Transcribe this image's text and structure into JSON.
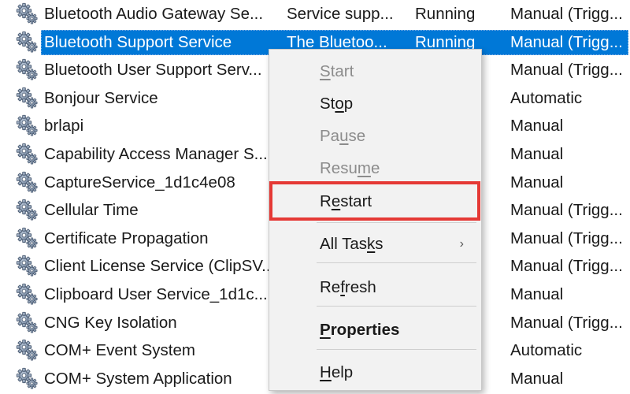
{
  "colors": {
    "selection": "#0078d7",
    "highlight_box": "#e53935",
    "menu_background": "#f2f2f2",
    "disabled_text": "#8c8c8c"
  },
  "row_icon": "gear-cog-icon",
  "services": [
    {
      "name": "Bluetooth Audio Gateway Se...",
      "description": "Service supp...",
      "status": "Running",
      "startup": "Manual (Trigg...",
      "selected": false
    },
    {
      "name": "Bluetooth Support Service",
      "description": "The Bluetoo...",
      "status": "Running",
      "startup": "Manual (Trigg...",
      "selected": true
    },
    {
      "name": "Bluetooth User Support Serv...",
      "description": "",
      "status": "",
      "startup": "Manual (Trigg...",
      "selected": false
    },
    {
      "name": "Bonjour Service",
      "description": "",
      "status": "",
      "startup": "Automatic",
      "selected": false
    },
    {
      "name": "brlapi",
      "description": "",
      "status": "",
      "startup": "Manual",
      "selected": false
    },
    {
      "name": "Capability Access Manager S...",
      "description": "",
      "status": "",
      "startup": "Manual",
      "selected": false
    },
    {
      "name": "CaptureService_1d1c4e08",
      "description": "",
      "status": "",
      "startup": "Manual",
      "selected": false
    },
    {
      "name": "Cellular Time",
      "description": "",
      "status": "",
      "startup": "Manual (Trigg...",
      "selected": false
    },
    {
      "name": "Certificate Propagation",
      "description": "",
      "status": "",
      "startup": "Manual (Trigg...",
      "selected": false
    },
    {
      "name": "Client License Service (ClipSV...",
      "description": "",
      "status": "",
      "startup": "Manual (Trigg...",
      "selected": false
    },
    {
      "name": "Clipboard User Service_1d1c...",
      "description": "",
      "status": "",
      "startup": "Manual",
      "selected": false
    },
    {
      "name": "CNG Key Isolation",
      "description": "",
      "status": "",
      "startup": "Manual (Trigg...",
      "selected": false
    },
    {
      "name": "COM+ Event System",
      "description": "",
      "status": "",
      "startup": "Automatic",
      "selected": false
    },
    {
      "name": "COM+ System Application",
      "description": "",
      "status": "",
      "startup": "Manual",
      "selected": false
    }
  ],
  "context_menu": {
    "items": [
      {
        "id": "start",
        "pre": "",
        "ul": "S",
        "post": "tart",
        "enabled": false
      },
      {
        "id": "stop",
        "pre": "St",
        "ul": "o",
        "post": "p",
        "enabled": true
      },
      {
        "id": "pause",
        "pre": "Pa",
        "ul": "u",
        "post": "se",
        "enabled": false
      },
      {
        "id": "resume",
        "pre": "Resu",
        "ul": "m",
        "post": "e",
        "enabled": false
      },
      {
        "id": "restart",
        "pre": "R",
        "ul": "e",
        "post": "start",
        "enabled": true,
        "highlighted": true
      },
      {
        "id": "all-tasks",
        "pre": "All Tas",
        "ul": "k",
        "post": "s",
        "enabled": true,
        "submenu": true,
        "submenu_arrow": "›"
      },
      {
        "id": "refresh",
        "pre": "Re",
        "ul": "f",
        "post": "resh",
        "enabled": true
      },
      {
        "id": "properties",
        "pre": "",
        "ul": "P",
        "post": "roperties",
        "enabled": true,
        "bold": true
      },
      {
        "id": "help",
        "pre": "",
        "ul": "H",
        "post": "elp",
        "enabled": true
      }
    ]
  }
}
